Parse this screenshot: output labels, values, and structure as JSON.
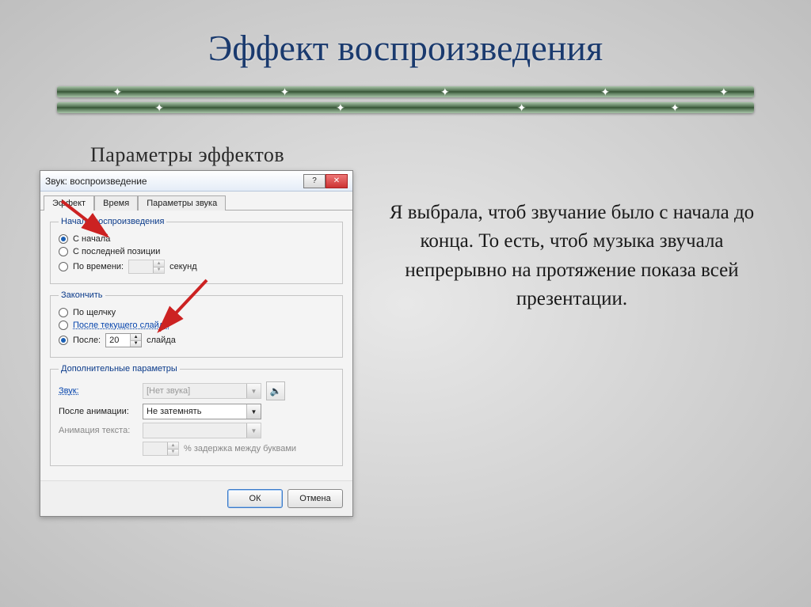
{
  "slide": {
    "title": "Эффект воспроизведения",
    "subtitle": "Параметры эффектов",
    "paragraph": "Я выбрала, чтоб звучание было с начала  до  конца. То есть, чтоб музыка звучала непрерывно на протяжение показа всей презентации."
  },
  "dialog": {
    "title": "Звук: воспроизведение",
    "tabs": {
      "effect": "Эффект",
      "time": "Время",
      "sound_params": "Параметры звука"
    },
    "groups": {
      "start_play": "Начало воспроизведения",
      "finish": "Закончить",
      "extra": "Дополнительные параметры"
    },
    "start": {
      "from_start": "С начала",
      "last_pos": "С последней позиции",
      "by_time": "По времени:",
      "seconds": "секунд"
    },
    "finish": {
      "on_click": "По щелчку",
      "after_current": "После текущего слайда",
      "after": "После:",
      "after_value": "20",
      "slides": "слайда"
    },
    "extra": {
      "sound_label": "Звук:",
      "sound_value": "[Нет звука]",
      "after_anim_label": "После анимации:",
      "after_anim_value": "Не затемнять",
      "text_anim_label": "Анимация текста:",
      "delay_label": "% задержка между буквами"
    },
    "buttons": {
      "ok": "ОК",
      "cancel": "Отмена"
    }
  }
}
